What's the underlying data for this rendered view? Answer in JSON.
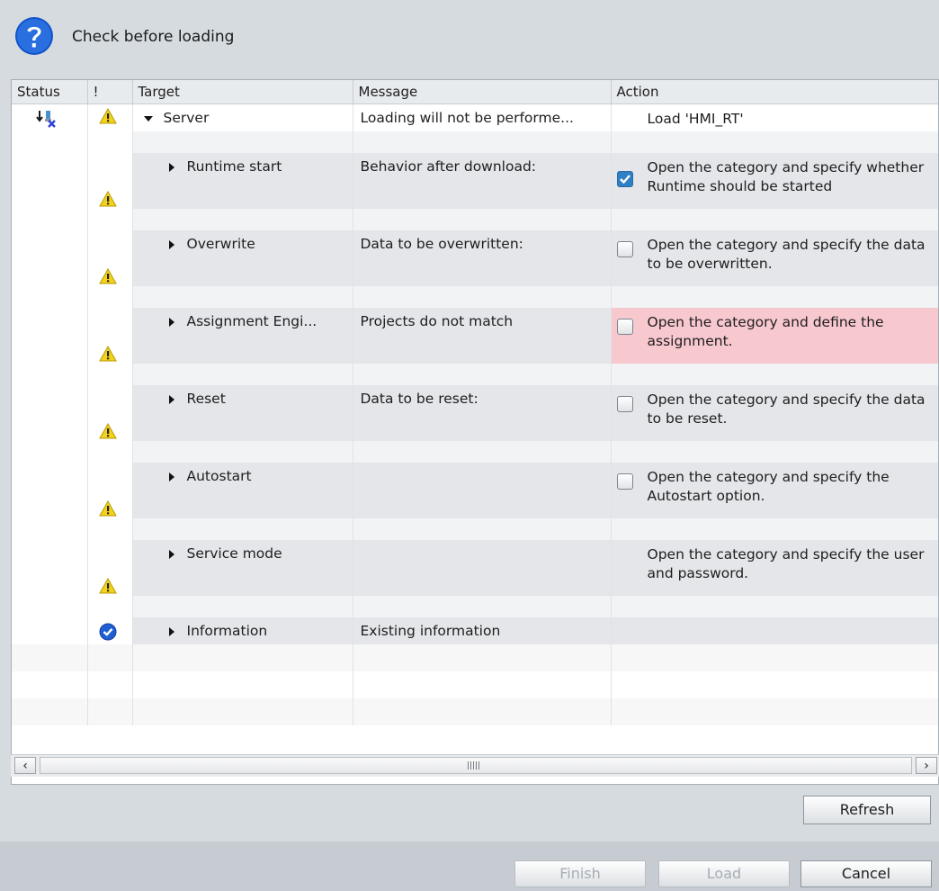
{
  "dialog": {
    "title": "Check before loading"
  },
  "columns": {
    "status": "Status",
    "bang": "!",
    "target": "Target",
    "message": "Message",
    "action": "Action"
  },
  "server_row": {
    "target": "Server",
    "message": "Loading will not be performe...",
    "action": "Load 'HMI_RT'"
  },
  "rows": [
    {
      "target": "Runtime start",
      "message": "Behavior after download:",
      "action": "Open the category and specify whether Runtime should be started",
      "checkbox": "checked",
      "icon": "warning-icon"
    },
    {
      "target": "Overwrite",
      "message": "Data to be overwritten:",
      "action": "Open the category and specify the data to be overwritten.",
      "checkbox": "unchecked",
      "icon": "warning-icon"
    },
    {
      "target": "Assignment Engi...",
      "message": "Projects do not match",
      "action": "Open the category and define the assignment.",
      "checkbox": "unchecked",
      "icon": "warning-icon",
      "highlight": "#f8c8cf"
    },
    {
      "target": "Reset",
      "message": "Data to be reset:",
      "action": "Open the category and specify the data to be reset.",
      "checkbox": "unchecked",
      "icon": "warning-icon"
    },
    {
      "target": "Autostart",
      "message": "",
      "action": "Open the category and specify the Autostart option.",
      "checkbox": "unchecked",
      "icon": "warning-icon"
    },
    {
      "target": "Service mode",
      "message": "",
      "action": "Open the category and specify the user and password.",
      "checkbox": "none",
      "icon": "warning-icon"
    },
    {
      "target": "Information",
      "message": "Existing information",
      "action": "",
      "checkbox": "none",
      "icon": "ok-check-icon"
    }
  ],
  "buttons": {
    "refresh": "Refresh",
    "finish": "Finish",
    "load": "Load",
    "cancel": "Cancel"
  },
  "colors": {
    "warning": "#f2d21a",
    "ok": "#1f5fd6",
    "highlight": "#f8c8cf",
    "checkbox_on": "#2e7fc4"
  }
}
